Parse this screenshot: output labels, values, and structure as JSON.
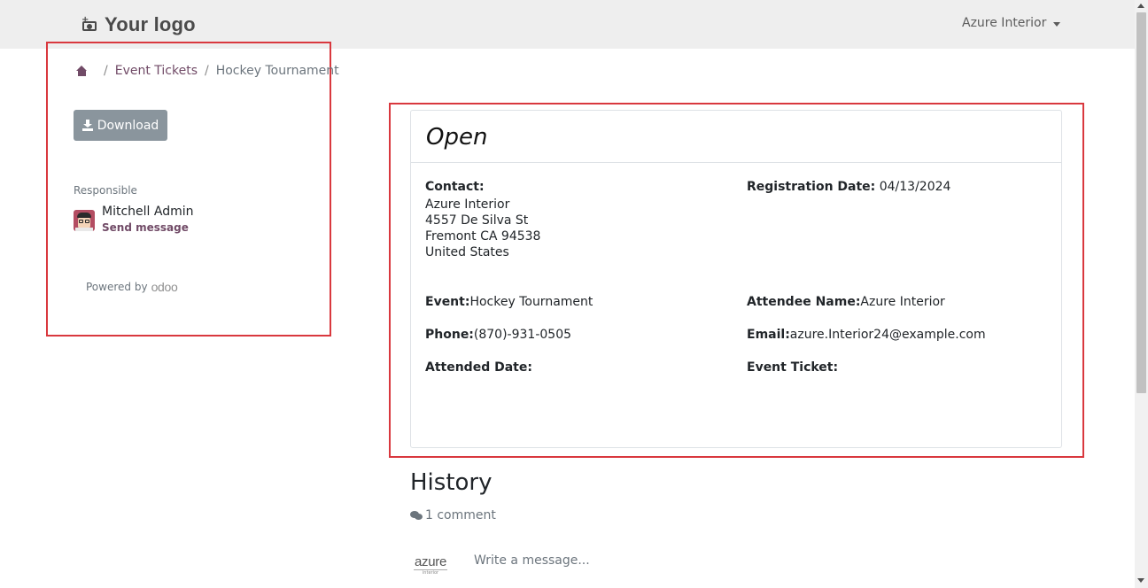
{
  "navbar": {
    "logo_text": "Your logo",
    "user_menu": "Azure Interior"
  },
  "breadcrumb": {
    "home_icon": "home-icon",
    "items": [
      "Event Tickets",
      "Hockey Tournament"
    ],
    "separator": "/"
  },
  "sidebar": {
    "download_label": "Download",
    "responsible_label": "Responsible",
    "responsible_name": "Mitchell Admin",
    "send_message": "Send message",
    "powered_by": "Powered by",
    "powered_brand": "odoo"
  },
  "ticket": {
    "status": "Open",
    "contact_label": "Contact:",
    "contact_name": "Azure Interior",
    "address_line1": "4557 De Silva St",
    "address_line2": "Fremont CA 94538",
    "address_line3": "United States",
    "registration_label": "Registration Date:",
    "registration_date": "04/13/2024",
    "event_label": "Event:",
    "event_value": "Hockey Tournament",
    "attendee_label": "Attendee Name:",
    "attendee_value": "Azure Interior",
    "phone_label": "Phone:",
    "phone_value": "(870)-931-0505",
    "email_label": "Email:",
    "email_value": "azure.Interior24@example.com",
    "attended_label": "Attended Date:",
    "event_ticket_label": "Event Ticket:"
  },
  "history": {
    "title": "History",
    "comments": "1 comment",
    "author_logo_main": "azure",
    "author_logo_sub": "interior",
    "message_placeholder": "Write a message..."
  },
  "colors": {
    "accent": "#714b67",
    "highlight": "#d9383e",
    "button": "#8a959d",
    "navbar": "#eeeeee"
  }
}
